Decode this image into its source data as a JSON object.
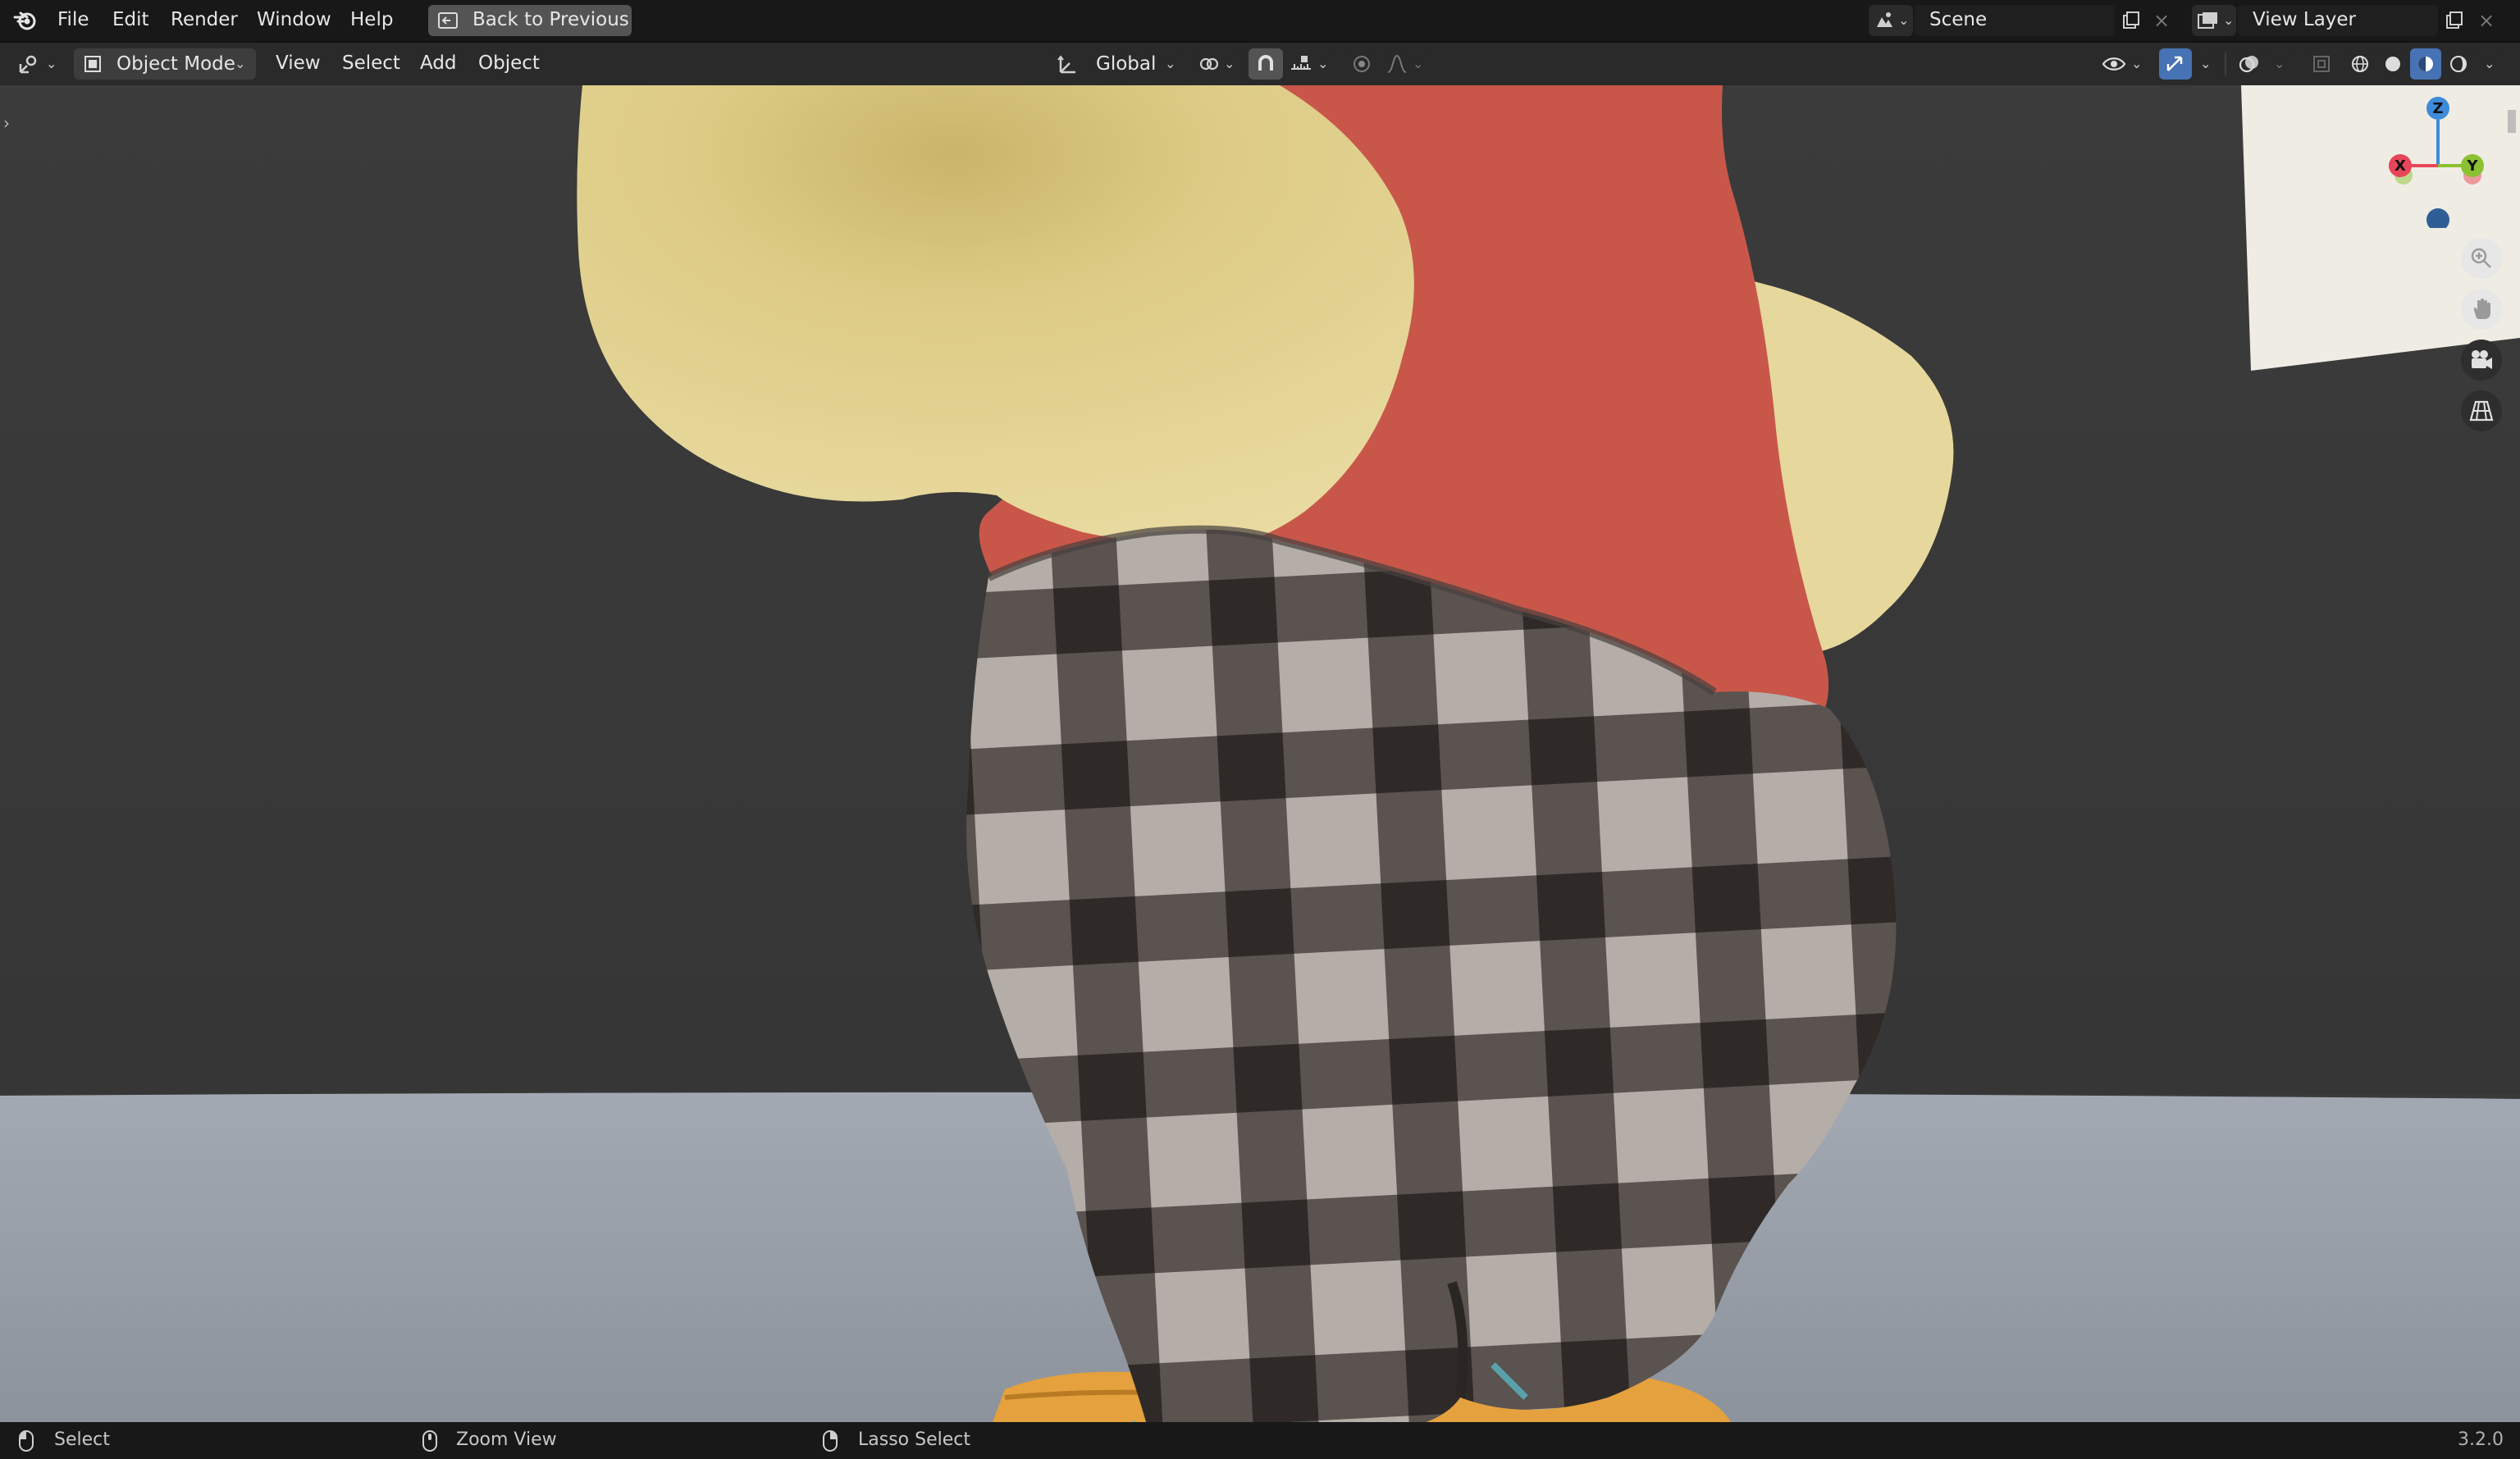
{
  "menu": {
    "file": "File",
    "edit": "Edit",
    "render": "Render",
    "window": "Window",
    "help": "Help",
    "back_to_previous": "Back to Previous"
  },
  "scene": {
    "label": "Scene"
  },
  "view_layer": {
    "label": "View Layer"
  },
  "header": {
    "mode": "Object Mode",
    "view": "View",
    "select": "Select",
    "add": "Add",
    "object": "Object",
    "orientation": "Global"
  },
  "gizmo": {
    "x": "X",
    "y": "Y",
    "z": "Z"
  },
  "statusbar": {
    "select": "Select",
    "zoom_view": "Zoom View",
    "lasso_select": "Lasso Select",
    "version": "3.2.0"
  },
  "colors": {
    "accent": "#4772b3",
    "axis_x": "#e8455a",
    "axis_y": "#8bc132",
    "axis_z": "#3d8bd9",
    "fur_yellow": "#e7d79a",
    "fur_red": "#c9574a",
    "plaid_dark": "#2f2a28",
    "plaid_light": "#b5aea8",
    "floor": "#9aa2ab",
    "background": "#3a3a3a"
  },
  "icons": [
    "blender-logo",
    "back-icon",
    "scene-icon",
    "new-scene-icon",
    "close-icon",
    "view-layer-icon",
    "editor-type-icon",
    "object-mode-icon",
    "transform-orientation-icon",
    "pivot-icon",
    "snap-icon",
    "snap-increment-icon",
    "proportional-edit-icon",
    "falloff-icon",
    "visibility-icon",
    "gizmo-toggle-icon",
    "overlay-icon",
    "xray-icon",
    "wireframe-shading-icon",
    "solid-shading-icon",
    "material-shading-icon",
    "rendered-shading-icon",
    "zoom-icon",
    "hand-icon",
    "camera-icon",
    "grid-icon",
    "mouse-left-icon",
    "mouse-middle-icon",
    "mouse-right-icon"
  ]
}
